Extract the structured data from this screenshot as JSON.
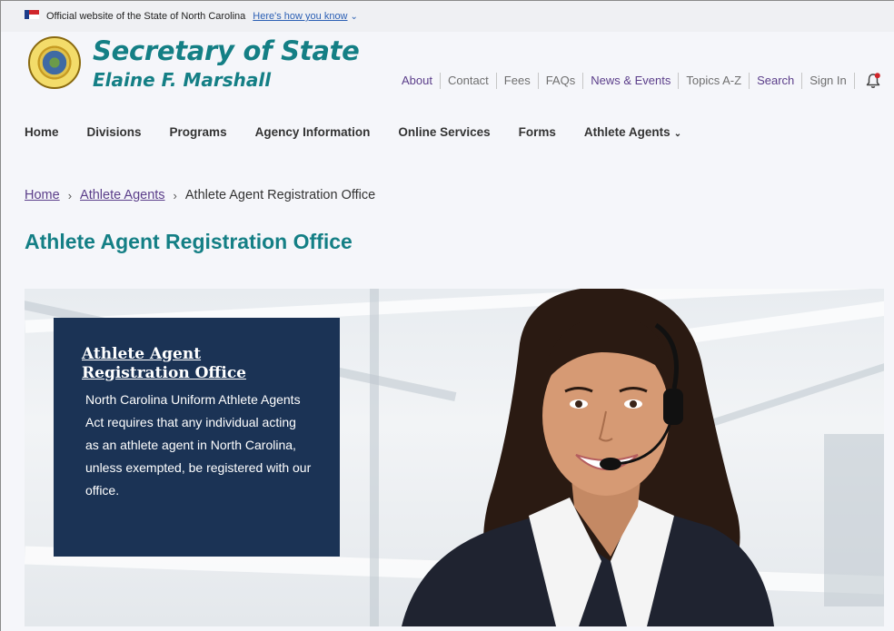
{
  "gov_banner": {
    "text": "Official website of the State of North Carolina",
    "link": "Here's how you know",
    "chevron": "⌄"
  },
  "header": {
    "title": "Secretary of State",
    "subtitle": "Elaine F. Marshall",
    "seal_icon": "nc-state-seal"
  },
  "utility_nav": [
    {
      "label": "About",
      "color": "#5b3e8a"
    },
    {
      "label": "Contact",
      "color": "#6f6f6f"
    },
    {
      "label": "Fees",
      "color": "#6f6f6f"
    },
    {
      "label": "FAQs",
      "color": "#6f6f6f"
    },
    {
      "label": "News & Events",
      "color": "#5b3e8a"
    },
    {
      "label": "Topics A-Z",
      "color": "#6f6f6f"
    },
    {
      "label": "Search",
      "color": "#5b3e8a"
    },
    {
      "label": "Sign In",
      "color": "#6f6f6f"
    }
  ],
  "main_nav": {
    "home": "Home",
    "divisions": "Divisions",
    "programs": "Programs",
    "agency": "Agency Information",
    "online": "Online Services",
    "forms": "Forms",
    "athlete": "Athlete Agents"
  },
  "breadcrumb": {
    "home": "Home",
    "section": "Athlete Agents",
    "current": "Athlete Agent Registration Office",
    "separator": "›"
  },
  "page_title": "Athlete Agent Registration Office",
  "hero": {
    "card_title": "Athlete Agent Registration Office",
    "card_text": "North Carolina Uniform Athlete Agents Act requires that any individual acting as an athlete agent in North Carolina, unless exempted, be registered with our office."
  },
  "colors": {
    "teal": "#147f85",
    "purple_link": "#5b3e8a",
    "card_bg": "#1b3355",
    "notification_dot": "#d0262b"
  }
}
